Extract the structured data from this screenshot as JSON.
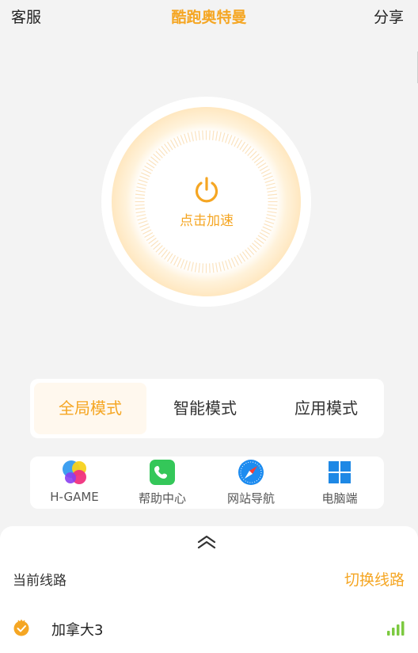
{
  "header": {
    "left_label": "客服",
    "title": "酷跑奥特曼",
    "right_label": "分享"
  },
  "power": {
    "label": "点击加速",
    "icon": "power-icon"
  },
  "modes": {
    "items": [
      {
        "label": "全局模式",
        "active": true
      },
      {
        "label": "智能模式",
        "active": false
      },
      {
        "label": "应用模式",
        "active": false
      }
    ]
  },
  "shortcuts": {
    "items": [
      {
        "label": "H-GAME",
        "icon": "game-icon"
      },
      {
        "label": "帮助中心",
        "icon": "phone-icon"
      },
      {
        "label": "网站导航",
        "icon": "compass-icon"
      },
      {
        "label": "电脑端",
        "icon": "windows-icon"
      }
    ]
  },
  "route": {
    "current_label": "当前线路",
    "switch_label": "切换线路",
    "name": "加拿大3",
    "signal_bars": 4
  },
  "colors": {
    "accent": "#f5a623",
    "signal": "#7cc940",
    "background": "#f3f3f3"
  }
}
